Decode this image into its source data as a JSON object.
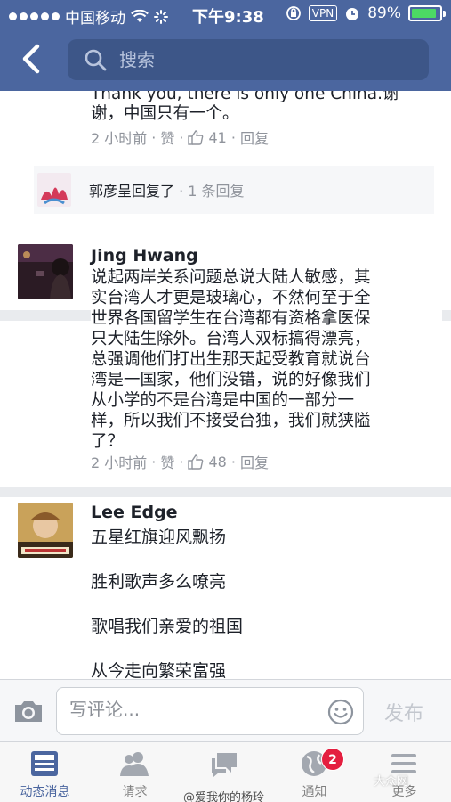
{
  "status_bar": {
    "carrier": "中国移动",
    "time": "下午9:38",
    "vpn": "VPN",
    "battery": "89%",
    "battery_level": 0.89
  },
  "header": {
    "search_placeholder": "搜索"
  },
  "comments": [
    {
      "text_partial_top": "Thank you, there is only one China.谢",
      "text_rest": "谢，中国只有一个。",
      "time": "2 小时前",
      "like": "赞",
      "likes": "41",
      "reply": "回复",
      "reply_summary": {
        "name": "郭彦呈回复了",
        "count": " · 1 条回复"
      }
    },
    {
      "author": "Jing Hwang",
      "lines": [
        "说起两岸关系问题总说大陆人敏感，其",
        "实台湾人才更是玻璃心，不然何至于全",
        "世界各国留学生在台湾都有资格拿医保",
        "只大陆生除外。台湾人双标搞得漂亮，",
        "总强调他们打出生那天起受教育就说台",
        "湾是一国家，他们没错，说的好像我们",
        "从小学的不是台湾是中国的一部分一",
        "样，所以我们不接受台独，我们就狭隘",
        "了？"
      ],
      "time": "2 小时前",
      "like": "赞",
      "likes": "48",
      "reply": "回复"
    },
    {
      "author": "Lee Edge",
      "lines": [
        "五星红旗迎风飘扬",
        "胜利歌声多么嘹亮",
        "歌唱我们亲爱的祖国",
        "从今走向繁荣富强"
      ]
    }
  ],
  "composer": {
    "placeholder": "写评论...",
    "publish": "发布"
  },
  "tabs": [
    {
      "label": "动态消息",
      "icon": "news-feed-icon"
    },
    {
      "label": "请求",
      "icon": "friend-requests-icon"
    },
    {
      "label": "",
      "icon": "messages-icon"
    },
    {
      "label": "通知",
      "icon": "notifications-globe-icon",
      "badge": "2"
    },
    {
      "label": "更多",
      "icon": "menu-icon"
    }
  ],
  "watermarks": {
    "center": "@爱我你的杨玲",
    "right": "大众网"
  },
  "colors": {
    "brand": "#4b669f",
    "badge": "#e41e3f",
    "battery": "#4cd964"
  }
}
